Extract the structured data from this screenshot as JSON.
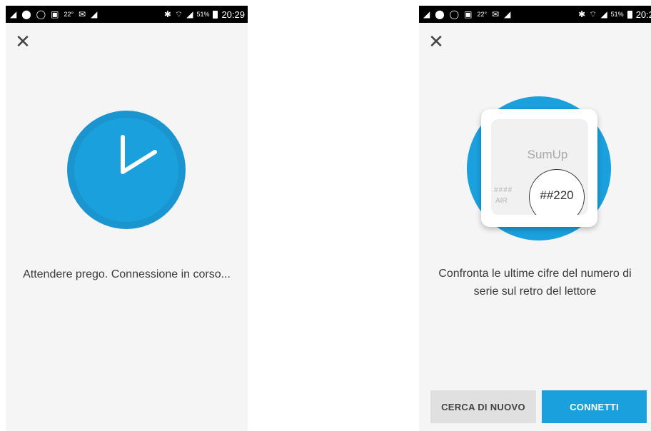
{
  "status_bar": {
    "temperature": "22°",
    "battery_percent": "51%",
    "left_screen_time": "20:29",
    "right_screen_time": "20:2",
    "icons": [
      "download-notification-icon",
      "location-icon",
      "whatsapp-icon",
      "gallery-icon",
      "temperature-icon",
      "mail-icon",
      "download-notification-icon",
      "bluetooth-icon",
      "wifi-icon",
      "signal-icon",
      "battery-icon"
    ]
  },
  "left_screen": {
    "message": "Attendere prego. Connessione in corso..."
  },
  "right_screen": {
    "card_brand": "SumUp",
    "serial_hash": "####",
    "model": "AIR",
    "serial_digits": "##220",
    "message": "Confronta le ultime cifre del numero di serie sul retro del lettore",
    "search_again_button": "CERCA DI NUOVO",
    "connect_button": "CONNETTI"
  },
  "colors": {
    "accent_blue": "#1aa0dd",
    "screen_background": "#f5f5f5",
    "secondary_button": "#e0e0e0"
  }
}
